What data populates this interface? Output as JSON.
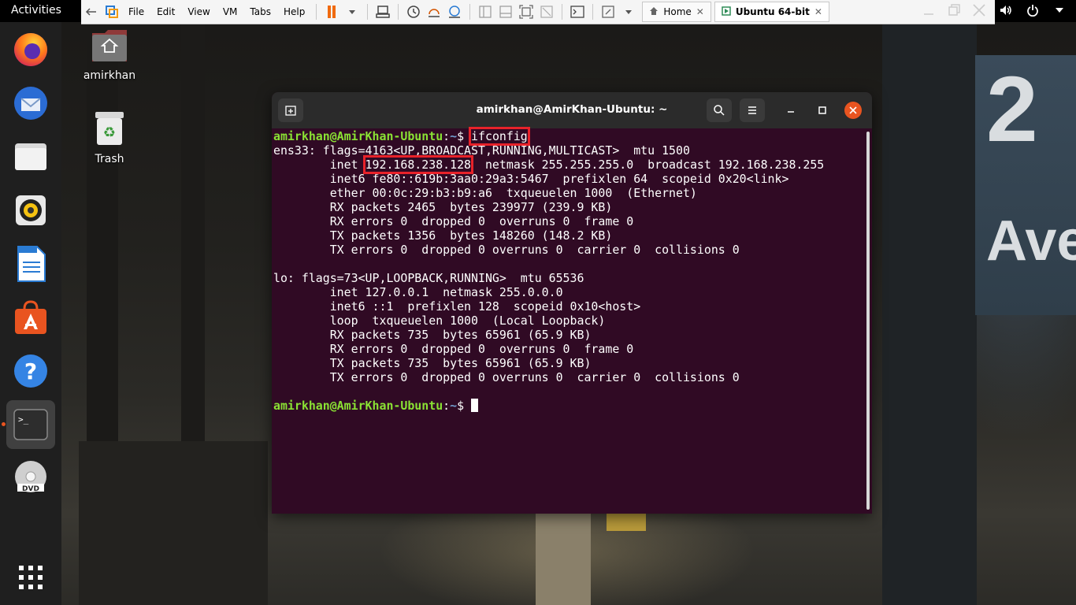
{
  "topbar": {
    "activities": "Activities",
    "tray_icons": [
      "network-icon",
      "volume-icon",
      "power-icon",
      "chevron-down-icon"
    ]
  },
  "vmware": {
    "menus": [
      "File",
      "Edit",
      "View",
      "VM",
      "Tabs",
      "Help"
    ],
    "tabs": [
      {
        "label": "Home",
        "active": false
      },
      {
        "label": "Ubuntu 64-bit",
        "active": true
      }
    ]
  },
  "dock": {
    "items": [
      "Firefox",
      "Thunderbird",
      "Files",
      "Rhythmbox",
      "LibreOffice Writer",
      "Ubuntu Software",
      "Help",
      "Terminal",
      "DVD",
      "Show Applications"
    ]
  },
  "desktop": {
    "home_label": "amirkhan",
    "trash_label": "Trash"
  },
  "terminal": {
    "title": "amirkhan@AmirKhan-Ubuntu: ~",
    "prompt_user": "amirkhan@AmirKhan-Ubuntu",
    "prompt_sep": ":",
    "prompt_path": "~",
    "prompt_dollar": "$ ",
    "command": "ifconfig",
    "ens33_flags": "ens33: flags=4163<UP,BROADCAST,RUNNING,MULTICAST>  mtu 1500",
    "inet_prefix": "        inet ",
    "inet_ip": "192.168.238.128",
    "inet_rest": "  netmask 255.255.255.0  broadcast 192.168.238.255",
    "ens33_lines": [
      "        inet6 fe80::619b:3aa0:29a3:5467  prefixlen 64  scopeid 0x20<link>",
      "        ether 00:0c:29:b3:b9:a6  txqueuelen 1000  (Ethernet)",
      "        RX packets 2465  bytes 239977 (239.9 KB)",
      "        RX errors 0  dropped 0  overruns 0  frame 0",
      "        TX packets 1356  bytes 148260 (148.2 KB)",
      "        TX errors 0  dropped 0 overruns 0  carrier 0  collisions 0"
    ],
    "lo_lines": [
      "lo: flags=73<UP,LOOPBACK,RUNNING>  mtu 65536",
      "        inet 127.0.0.1  netmask 255.0.0.0",
      "        inet6 ::1  prefixlen 128  scopeid 0x10<host>",
      "        loop  txqueuelen 1000  (Local Loopback)",
      "        RX packets 735  bytes 65961 (65.9 KB)",
      "        RX errors 0  dropped 0  overruns 0  frame 0",
      "        TX packets 735  bytes 65961 (65.9 KB)",
      "        TX errors 0  dropped 0 overruns 0  carrier 0  collisions 0"
    ]
  },
  "colors": {
    "terminal_bg": "#300a24",
    "prompt_user": "#8ae234",
    "prompt_path": "#729fcf",
    "highlight_box": "#e8222a",
    "close_button": "#e95420"
  }
}
